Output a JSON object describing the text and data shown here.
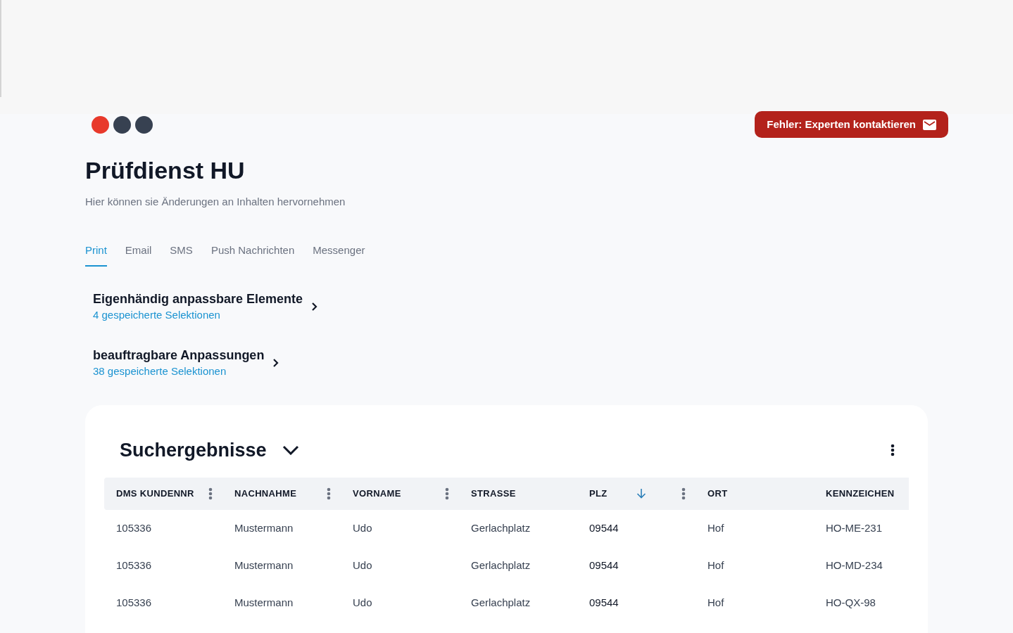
{
  "window_dots": [
    {
      "color": "#e8392b"
    },
    {
      "color": "#374151"
    },
    {
      "color": "#374151"
    }
  ],
  "contact_button": {
    "label": "Fehler: Experten kontaktieren"
  },
  "header": {
    "title": "Prüfdienst HU",
    "subtitle": "Hier können sie Änderungen an Inhalten hervornehmen"
  },
  "tabs": [
    {
      "label": "Print",
      "selected": true
    },
    {
      "label": "Email",
      "selected": false
    },
    {
      "label": "SMS",
      "selected": false
    },
    {
      "label": "Push Nachrichten",
      "selected": false
    },
    {
      "label": "Messenger",
      "selected": false
    }
  ],
  "sections": [
    {
      "title": "Eigenhändig anpassbare Elemente",
      "subtitle": "4 gespeicherte Selektionen"
    },
    {
      "title": "beauftragbare Anpassungen",
      "subtitle": "38 gespeicherte Selektionen"
    }
  ],
  "results": {
    "title": "Suchergebnisse",
    "expanded": true,
    "columns": [
      {
        "label": "DMS KUNDENNR",
        "menu": true,
        "sorted": false
      },
      {
        "label": "NACHNAHME",
        "menu": true,
        "sorted": false
      },
      {
        "label": "VORNAME",
        "menu": true,
        "sorted": false
      },
      {
        "label": "STRASSE",
        "menu": false,
        "sorted": false
      },
      {
        "label": "PLZ",
        "menu": true,
        "sorted": true
      },
      {
        "label": "ORT",
        "menu": false,
        "sorted": false
      },
      {
        "label": "KENNZEICHEN",
        "menu": false,
        "sorted": false
      }
    ],
    "rows": [
      [
        "105336",
        "Mustermann",
        "Udo",
        "Gerlachplatz",
        "09544",
        "Hof",
        "HO-ME-231"
      ],
      [
        "105336",
        "Mustermann",
        "Udo",
        "Gerlachplatz",
        "09544",
        "Hof",
        "HO-MD-234"
      ],
      [
        "105336",
        "Mustermann",
        "Udo",
        "Gerlachplatz",
        "09544",
        "Hof",
        "HO-QX-98"
      ]
    ]
  }
}
